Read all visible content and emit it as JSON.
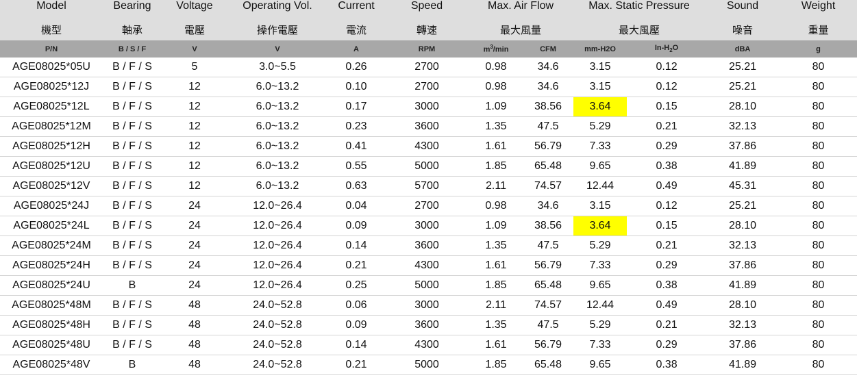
{
  "header": {
    "model_en": "Model",
    "model_zh": "機型",
    "model_unit": "P/N",
    "bearing_en": "Bearing",
    "bearing_zh": "軸承",
    "bearing_unit": "B / S / F",
    "voltage_en": "Voltage",
    "voltage_zh": "電壓",
    "voltage_unit": "V",
    "opvol_en": "Operating Vol.",
    "opvol_zh": "操作電壓",
    "opvol_unit": "V",
    "current_en": "Current",
    "current_zh": "電流",
    "current_unit": "A",
    "speed_en": "Speed",
    "speed_zh": "轉速",
    "speed_unit": "RPM",
    "airflow_en": "Max. Air Flow",
    "airflow_zh": "最大風量",
    "airflow_unit1_base": "m",
    "airflow_unit1_sup": "3",
    "airflow_unit1_tail": "/min",
    "airflow_unit2": "CFM",
    "pressure_en": "Max. Static Pressure",
    "pressure_zh": "最大風壓",
    "pressure_unit1": "mm-H2O",
    "pressure_unit2_base": "In-H",
    "pressure_unit2_sub": "2",
    "pressure_unit2_tail": "O",
    "sound_en": "Sound",
    "sound_zh": "噪音",
    "sound_unit": "dBA",
    "weight_en": "Weight",
    "weight_zh": "重量",
    "weight_unit": "g"
  },
  "highlight_color": "#ffff00",
  "rows": [
    {
      "model": "AGE08025*05U",
      "bearing": "B / F / S",
      "voltage": "5",
      "opvol": "3.0~5.5",
      "current": "0.26",
      "speed": "2700",
      "m3min": "0.98",
      "cfm": "34.6",
      "mmh2o": "3.15",
      "inh2o": "0.12",
      "dba": "25.21",
      "weight": "80",
      "highlight": false
    },
    {
      "model": "AGE08025*12J",
      "bearing": "B / F / S",
      "voltage": "12",
      "opvol": "6.0~13.2",
      "current": "0.10",
      "speed": "2700",
      "m3min": "0.98",
      "cfm": "34.6",
      "mmh2o": "3.15",
      "inh2o": "0.12",
      "dba": "25.21",
      "weight": "80",
      "highlight": false
    },
    {
      "model": "AGE08025*12L",
      "bearing": "B / F / S",
      "voltage": "12",
      "opvol": "6.0~13.2",
      "current": "0.17",
      "speed": "3000",
      "m3min": "1.09",
      "cfm": "38.56",
      "mmh2o": "3.64",
      "inh2o": "0.15",
      "dba": "28.10",
      "weight": "80",
      "highlight": true
    },
    {
      "model": "AGE08025*12M",
      "bearing": "B / F / S",
      "voltage": "12",
      "opvol": "6.0~13.2",
      "current": "0.23",
      "speed": "3600",
      "m3min": "1.35",
      "cfm": "47.5",
      "mmh2o": "5.29",
      "inh2o": "0.21",
      "dba": "32.13",
      "weight": "80",
      "highlight": false
    },
    {
      "model": "AGE08025*12H",
      "bearing": "B / F / S",
      "voltage": "12",
      "opvol": "6.0~13.2",
      "current": "0.41",
      "speed": "4300",
      "m3min": "1.61",
      "cfm": "56.79",
      "mmh2o": "7.33",
      "inh2o": "0.29",
      "dba": "37.86",
      "weight": "80",
      "highlight": false
    },
    {
      "model": "AGE08025*12U",
      "bearing": "B / F / S",
      "voltage": "12",
      "opvol": "6.0~13.2",
      "current": "0.55",
      "speed": "5000",
      "m3min": "1.85",
      "cfm": "65.48",
      "mmh2o": "9.65",
      "inh2o": "0.38",
      "dba": "41.89",
      "weight": "80",
      "highlight": false
    },
    {
      "model": "AGE08025*12V",
      "bearing": "B / F / S",
      "voltage": "12",
      "opvol": "6.0~13.2",
      "current": "0.63",
      "speed": "5700",
      "m3min": "2.11",
      "cfm": "74.57",
      "mmh2o": "12.44",
      "inh2o": "0.49",
      "dba": "45.31",
      "weight": "80",
      "highlight": false
    },
    {
      "model": "AGE08025*24J",
      "bearing": "B / F / S",
      "voltage": "24",
      "opvol": "12.0~26.4",
      "current": "0.04",
      "speed": "2700",
      "m3min": "0.98",
      "cfm": "34.6",
      "mmh2o": "3.15",
      "inh2o": "0.12",
      "dba": "25.21",
      "weight": "80",
      "highlight": false
    },
    {
      "model": "AGE08025*24L",
      "bearing": "B / F / S",
      "voltage": "24",
      "opvol": "12.0~26.4",
      "current": "0.09",
      "speed": "3000",
      "m3min": "1.09",
      "cfm": "38.56",
      "mmh2o": "3.64",
      "inh2o": "0.15",
      "dba": "28.10",
      "weight": "80",
      "highlight": true
    },
    {
      "model": "AGE08025*24M",
      "bearing": "B / F / S",
      "voltage": "24",
      "opvol": "12.0~26.4",
      "current": "0.14",
      "speed": "3600",
      "m3min": "1.35",
      "cfm": "47.5",
      "mmh2o": "5.29",
      "inh2o": "0.21",
      "dba": "32.13",
      "weight": "80",
      "highlight": false
    },
    {
      "model": "AGE08025*24H",
      "bearing": "B / F / S",
      "voltage": "24",
      "opvol": "12.0~26.4",
      "current": "0.21",
      "speed": "4300",
      "m3min": "1.61",
      "cfm": "56.79",
      "mmh2o": "7.33",
      "inh2o": "0.29",
      "dba": "37.86",
      "weight": "80",
      "highlight": false
    },
    {
      "model": "AGE08025*24U",
      "bearing": "B",
      "voltage": "24",
      "opvol": "12.0~26.4",
      "current": "0.25",
      "speed": "5000",
      "m3min": "1.85",
      "cfm": "65.48",
      "mmh2o": "9.65",
      "inh2o": "0.38",
      "dba": "41.89",
      "weight": "80",
      "highlight": false
    },
    {
      "model": "AGE08025*48M",
      "bearing": "B / F / S",
      "voltage": "48",
      "opvol": "24.0~52.8",
      "current": "0.06",
      "speed": "3000",
      "m3min": "2.11",
      "cfm": "74.57",
      "mmh2o": "12.44",
      "inh2o": "0.49",
      "dba": "28.10",
      "weight": "80",
      "highlight": false
    },
    {
      "model": "AGE08025*48H",
      "bearing": "B / F / S",
      "voltage": "48",
      "opvol": "24.0~52.8",
      "current": "0.09",
      "speed": "3600",
      "m3min": "1.35",
      "cfm": "47.5",
      "mmh2o": "5.29",
      "inh2o": "0.21",
      "dba": "32.13",
      "weight": "80",
      "highlight": false
    },
    {
      "model": "AGE08025*48U",
      "bearing": "B / F / S",
      "voltage": "48",
      "opvol": "24.0~52.8",
      "current": "0.14",
      "speed": "4300",
      "m3min": "1.61",
      "cfm": "56.79",
      "mmh2o": "7.33",
      "inh2o": "0.29",
      "dba": "37.86",
      "weight": "80",
      "highlight": false
    },
    {
      "model": "AGE08025*48V",
      "bearing": "B",
      "voltage": "48",
      "opvol": "24.0~52.8",
      "current": "0.21",
      "speed": "5000",
      "m3min": "1.85",
      "cfm": "65.48",
      "mmh2o": "9.65",
      "inh2o": "0.38",
      "dba": "41.89",
      "weight": "80",
      "highlight": false
    }
  ]
}
